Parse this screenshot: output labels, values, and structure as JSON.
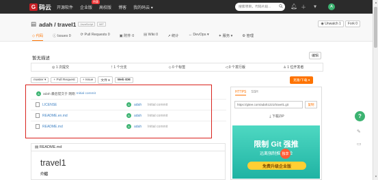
{
  "topnav": {
    "logo_letter": "G",
    "logo_text": "码云",
    "items": [
      "开源软件",
      "企业版",
      "高校版",
      "博客",
      "我的码云 ▾"
    ],
    "badge": "特惠",
    "search_placeholder": "搜索项目，代码片段...",
    "avatar": "A"
  },
  "repo": {
    "owner_repo": "adah / travel1",
    "tags": [
      "JavaScript",
      "MIT"
    ],
    "unwatch": "◉ Unwatch 1",
    "fork": "Fork 0",
    "tabs": [
      "◇ 代码",
      "ⓘ Issues 0",
      "⟳ Pull Requests 0",
      "▣ 附件 0",
      "▤ Wiki 0",
      "↗ 统计",
      "↔ DevOps ▾",
      "✦ 服务 ▾",
      "⚙ 管理"
    ]
  },
  "description": "暂无描述",
  "edit_label": "编辑",
  "stats": [
    "◎ 1 次提交",
    "ᚠ 1 个分支",
    "◇ 0 个标签",
    "◁ 0 个发行版",
    "♙ 1 位开发者"
  ],
  "branch_bar": {
    "branch": "master ▾",
    "pull_request": "+ Pull Request",
    "issue": "+ Issue",
    "file": "文件 ▾",
    "webide": "Web IDE",
    "clone": "克隆/下载 ▾"
  },
  "commit": {
    "avatar": "A",
    "text": "adah 最后提交于 刚刚",
    "message": "Initial commit"
  },
  "files": [
    {
      "name": "LICENSE",
      "author": "adah",
      "commit": "Initial commit",
      "avatar": "A"
    },
    {
      "name": "README.en.md",
      "author": "adah",
      "commit": "Initial commit",
      "avatar": "A"
    },
    {
      "name": "README.md",
      "author": "adah",
      "commit": "Initial commit",
      "avatar": "A"
    }
  ],
  "readme": {
    "header": "▤ README.md",
    "title": "travel1",
    "subtitle": "介绍"
  },
  "clone_panel": {
    "tabs": [
      "HTTPS",
      "SSH"
    ],
    "url": "https://gitee.com/adah1221/travel1.git",
    "copy": "复制",
    "download": "⤓ 下载ZIP",
    "promo_title": "限制 Git 强推",
    "promo_sub": "远离强制推送风险",
    "promo_badge": "独享",
    "promo_button": "免费升级企业版"
  },
  "help_label": "?"
}
